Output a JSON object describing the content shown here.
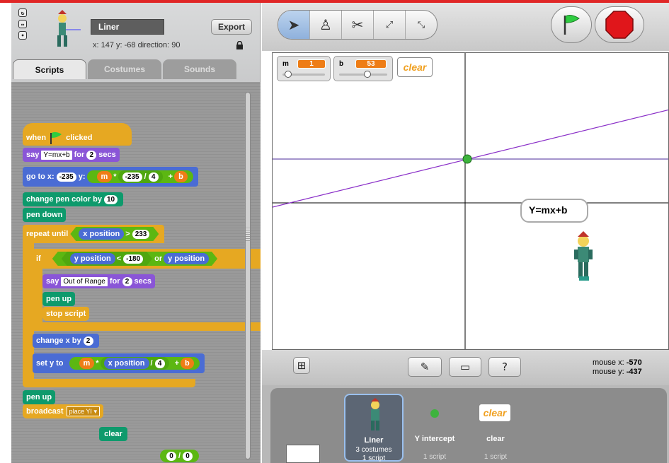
{
  "sprite": {
    "name": "Liner",
    "export_label": "Export",
    "info": "x: 147  y: -68   direction: 90"
  },
  "tabs": [
    "Scripts",
    "Costumes",
    "Sounds"
  ],
  "script": {
    "hat": {
      "when": "when",
      "clicked": "clicked"
    },
    "say1": {
      "say": "say",
      "text": "Y=mx+b",
      "for": "for",
      "secs_val": "2",
      "secs": "secs"
    },
    "goto": {
      "label": "go to x:",
      "x": "-235",
      "y_label": "y:",
      "m": "m",
      "times": "*",
      "num": "-235",
      "div": "/",
      "four": "4",
      "plus": "+",
      "b": "b"
    },
    "pen_color": {
      "label": "change pen color by",
      "val": "10"
    },
    "pen_down": "pen down",
    "repeat_until": {
      "label": "repeat until",
      "xpos": "x position",
      "gt": ">",
      "val": "233"
    },
    "if": {
      "label": "if",
      "ypos1": "y position",
      "lt": "<",
      "val": "-180",
      "or": "or",
      "ypos2": "y position"
    },
    "say2": {
      "say": "say",
      "text": "Out of Range",
      "for": "for",
      "secs_val": "2",
      "secs": "secs"
    },
    "pen_up_inner": "pen up",
    "stop_script": "stop script",
    "change_x": {
      "label": "change x by",
      "val": "2"
    },
    "set_y": {
      "label": "set y to",
      "m": "m",
      "times": "*",
      "xpos": "x position",
      "div": "/",
      "four": "4",
      "plus": "+",
      "b": "b"
    },
    "pen_up": "pen up",
    "broadcast": {
      "label": "broadcast",
      "msg": "place YI"
    },
    "clear_block": "clear",
    "loose_div": {
      "a": "0",
      "op": "/",
      "b": "0"
    }
  },
  "stage": {
    "monitors": [
      {
        "name": "m",
        "value": "1",
        "fraction": 0.05
      },
      {
        "name": "b",
        "value": "53",
        "fraction": 0.6
      }
    ],
    "clear_button": "clear",
    "speech": "Y=mx+b"
  },
  "mouse": {
    "x_label": "mouse x:",
    "x_val": "-570",
    "y_label": "mouse y:",
    "y_val": "-437"
  },
  "sprites": [
    {
      "name": "Liner",
      "line1": "3 costumes",
      "line2": "1 script"
    },
    {
      "name": "Y intercept",
      "line1": "",
      "line2": "1 script"
    },
    {
      "name": "clear",
      "line1": "",
      "line2": "1 script",
      "button": "clear"
    }
  ],
  "colors": {
    "looks": "#8a55d7",
    "motion": "#4a6cd4",
    "pen": "#0e9a6c",
    "control": "#e6a822",
    "operators": "#5cb712",
    "variables": "#ee7d16",
    "line": "#8a2fc8"
  },
  "icons": [
    "rotate-full-icon",
    "rotate-flip-icon",
    "rotate-none-icon",
    "lock-icon",
    "arrow-tool-icon",
    "stamp-tool-icon",
    "scissors-tool-icon",
    "grow-tool-icon",
    "shrink-tool-icon",
    "green-flag-icon",
    "stop-sign-icon",
    "presentation-mode-icon",
    "paint-new-sprite-icon",
    "folder-sprite-icon",
    "random-sprite-icon"
  ]
}
